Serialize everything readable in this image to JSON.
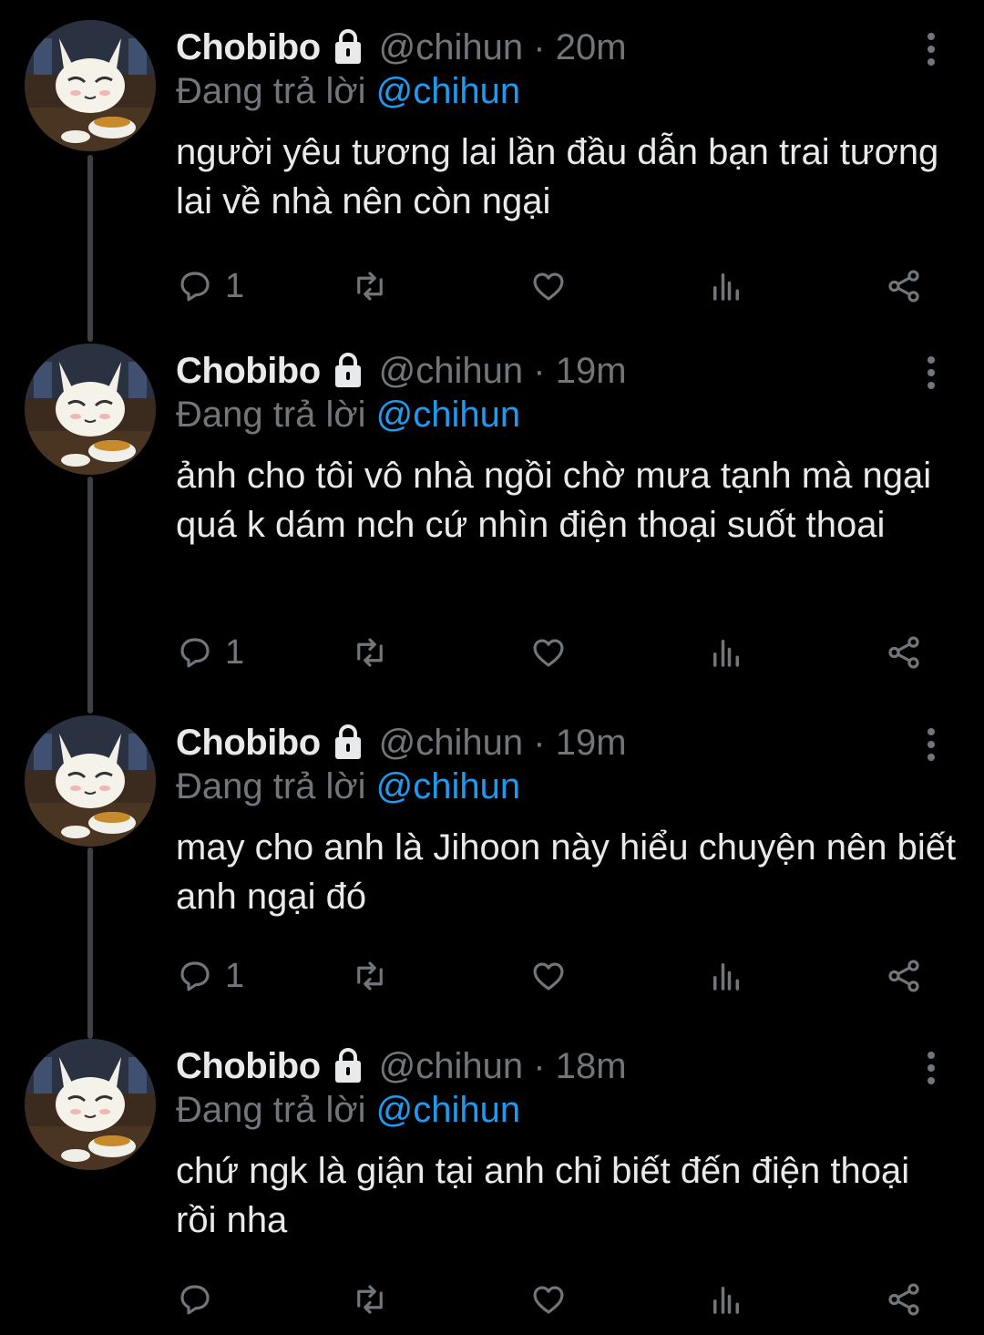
{
  "accent_color": "#1d9bf0",
  "icons": {
    "lock": "lock-icon",
    "reply": "reply-icon",
    "retweet": "retweet-icon",
    "like": "like-icon",
    "views": "views-icon",
    "share": "share-icon",
    "more": "more-icon"
  },
  "tweets": [
    {
      "name": "Chobibo",
      "handle": "@chihun",
      "time": "· 20m",
      "reply_prefix": "Đang trả lời",
      "reply_to": "@chihun",
      "text": "người yêu tương lai lần đầu dẫn bạn trai tương lai về nhà nên còn ngại",
      "reply_count": "1"
    },
    {
      "name": "Chobibo",
      "handle": "@chihun",
      "time": "· 19m",
      "reply_prefix": "Đang trả lời",
      "reply_to": "@chihun",
      "text": "ảnh cho tôi vô nhà ngồi chờ mưa tạnh mà ngại quá k dám nch cứ nhìn điện thoại suốt thoai",
      "reply_count": "1"
    },
    {
      "name": "Chobibo",
      "handle": "@chihun",
      "time": "· 19m",
      "reply_prefix": "Đang trả lời",
      "reply_to": "@chihun",
      "text": "may cho anh là Jihoon này hiểu chuyện nên biết anh ngại đó",
      "reply_count": "1"
    },
    {
      "name": "Chobibo",
      "handle": "@chihun",
      "time": "· 18m",
      "reply_prefix": "Đang trả lời",
      "reply_to": "@chihun",
      "text": "chứ ngk là giận tại anh chỉ biết đến điện thoại rồi nha",
      "reply_count": ""
    }
  ]
}
